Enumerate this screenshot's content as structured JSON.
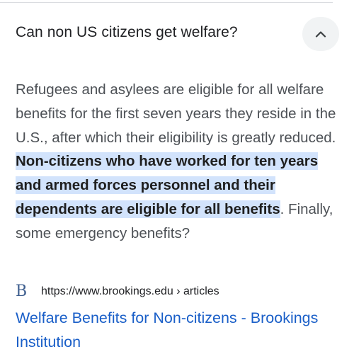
{
  "question": {
    "text": "Can non US citizens get welfare?",
    "toggle_icon": "chevron-up-icon",
    "expanded": true
  },
  "answer": {
    "part1": "Refugees and asylees are eligible for all welfare benefits for the first seven years they reside in the U.S., after which their eligibility is greatly reduced. ",
    "highlight": "Non-citizens who have worked for ten years and armed forces personnel and their dependents are eligible for all benefits",
    "part2": ". Finally, some emergency benefits?"
  },
  "source": {
    "favicon_letter": "B",
    "url": "https://www.brookings.edu › articles",
    "title": "Welfare Benefits for Non-citizens - Brookings Institution"
  },
  "colors": {
    "highlight_bg": "#d2e3fc",
    "link": "#1a5fc8",
    "body_text": "#4d5156",
    "button_bg": "#f1f3f4"
  }
}
